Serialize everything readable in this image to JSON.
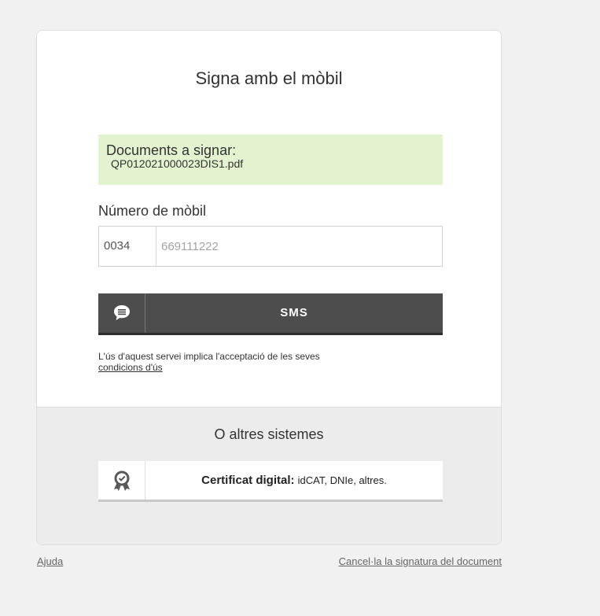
{
  "header": {
    "title": "Signa amb el mòbil"
  },
  "documents": {
    "label": "Documents a signar:",
    "files": [
      "QP012021000023DIS1.pdf"
    ]
  },
  "mobile": {
    "label": "Número de mòbil",
    "prefix": "0034",
    "placeholder": "669111222"
  },
  "sms_button": {
    "label": "SMS",
    "icon": "chat-bubble-icon"
  },
  "terms": {
    "text": "L'ús d'aquest servei implica l'acceptació de les seves",
    "link": "condicions d'ús"
  },
  "other": {
    "title": "O altres sistemes",
    "certificate_button": {
      "bold_label": "Certificat digital:",
      "rest_label": "idCAT, DNIe, altres.",
      "icon": "certificate-badge-icon"
    }
  },
  "footer": {
    "help_link": "Ajuda",
    "cancel_link": "Cancel·la la signatura del document"
  },
  "colors": {
    "background": "#f1f1f1",
    "docs_highlight": "#e3f3cf",
    "sms_button": "#4d4d4d",
    "other_section": "#ececec"
  }
}
